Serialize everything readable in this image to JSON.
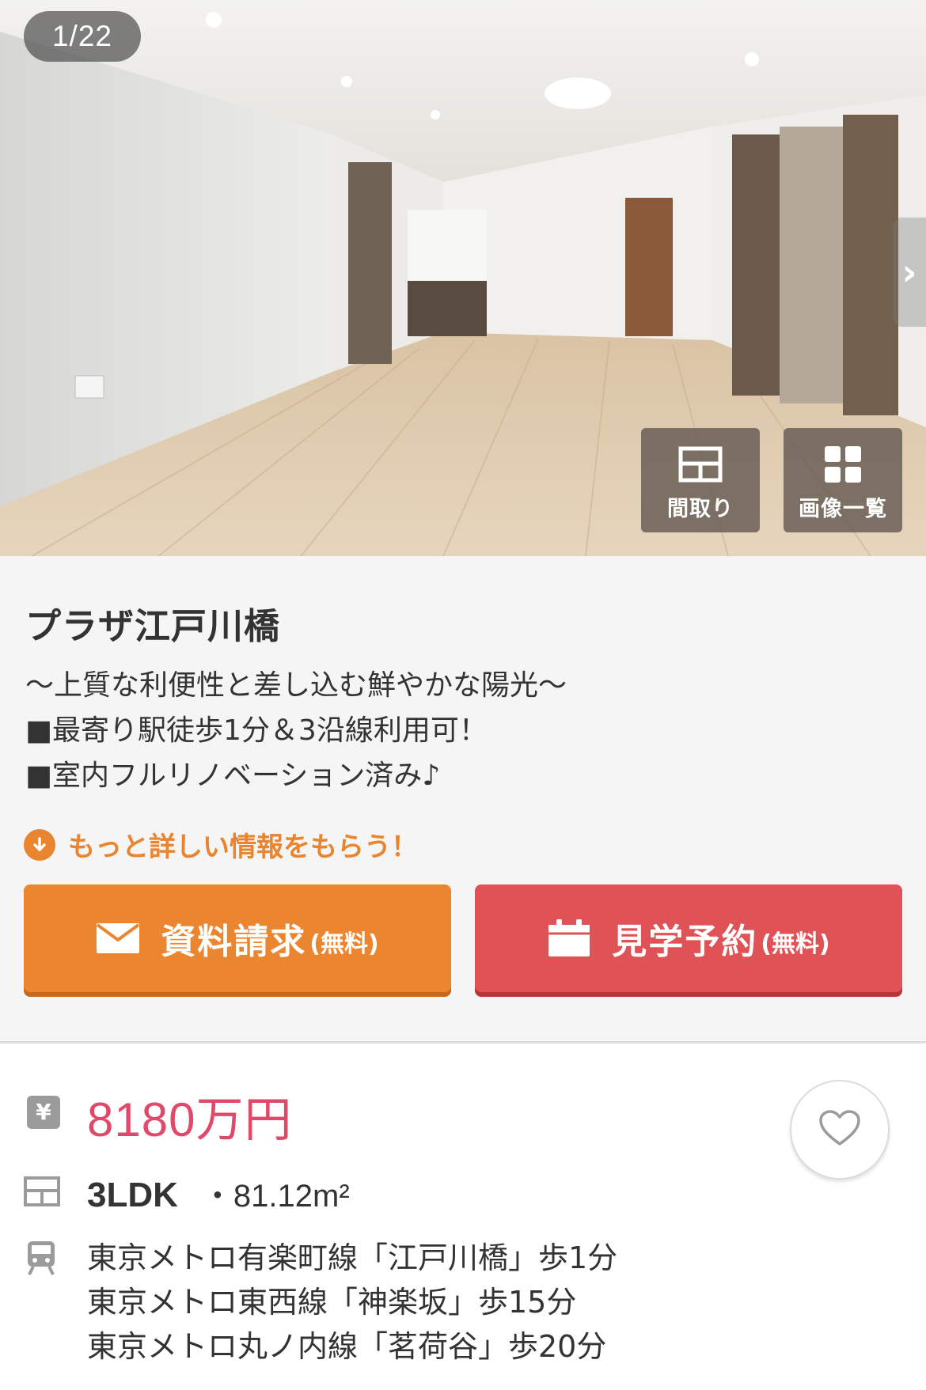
{
  "gallery": {
    "counter": "1/22",
    "floorplan_label": "間取り",
    "image_list_label": "画像一覧"
  },
  "property": {
    "name": "プラザ江戸川橋",
    "catchphrase": "〜上質な利便性と差し込む鮮やかな陽光〜",
    "features": [
      "■最寄り駅徒歩1分＆3沿線利用可！",
      "■室内フルリノベーション済み♪"
    ]
  },
  "more_info": {
    "label": "もっと詳しい情報をもらう！"
  },
  "buttons": {
    "request": {
      "label": "資料請求",
      "note": "(無料)"
    },
    "visit": {
      "label": "見学予約",
      "note": "(無料)"
    }
  },
  "details": {
    "price": "8180万円",
    "layout": "3LDK",
    "area": "・81.12m²",
    "stations": [
      "東京メトロ有楽町線「江戸川橋」歩1分",
      "東京メトロ東西線「神楽坂」歩15分",
      "東京メトロ丸ノ内線「茗荷谷」歩20分"
    ]
  },
  "icons": {
    "yen": "¥",
    "floorplan": "floorplan-icon",
    "gallery": "grid-icon",
    "train": "train-icon",
    "mail": "mail-icon",
    "calendar": "calendar-icon",
    "favorite": "heart-icon",
    "next": "chevron-right-icon",
    "download": "arrow-down-circle-icon"
  },
  "colors": {
    "orange": "#ec8530",
    "red": "#df5256",
    "price": "#e04a6a",
    "accent_text": "#e9842f"
  }
}
